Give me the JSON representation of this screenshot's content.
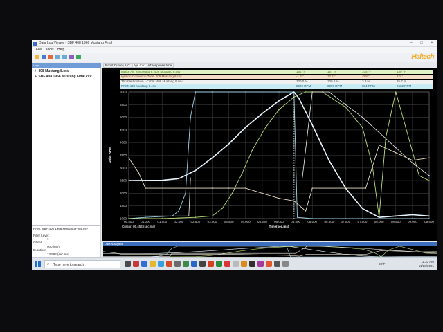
{
  "window": {
    "title": "Data Log Viewer - SBF 408 1966 Mustang Final",
    "logo_text": "Haltech"
  },
  "menu": {
    "items": [
      "File",
      "Tools",
      "Help"
    ]
  },
  "left_panel": {
    "header": "Logs",
    "files": [
      "408 Mustang 8.csv",
      "SBF 408 1966 Mustang Final.csv"
    ],
    "selected_series": "RPM: SBF 408 1966 Mustang Final.csv",
    "filter_label": "Filter Level:",
    "filter_value": "1",
    "offset_label": "Offset:",
    "offset_value": "000 (ms)",
    "duration_label": "Duration:",
    "duration_value": "13.592 (sec.ms)"
  },
  "tabs": [
    {
      "label": "Boost Curve",
      "active": false
    },
    {
      "label": "IAT",
      "active": false
    },
    {
      "label": "Ign Corr",
      "active": true
    },
    {
      "label": "IAT response time",
      "active": false
    }
  ],
  "legend": [
    {
      "name": "Intake Air Temperature: 408 Mustang 8.csv",
      "cursor": "154 °F",
      "max": "157 °F",
      "min": "105 °F",
      "avg": "130 °F",
      "bg": "#dff2c4",
      "color": "#5a7f1c"
    },
    {
      "name": "Ignition Correction Total: 408 Mustang 8.csv",
      "cursor": "-1.6 °",
      "max": "12.4 °",
      "min": "-3.8 °",
      "avg": "2.1 °",
      "bg": "#f3dcc8",
      "color": "#7a4c26"
    },
    {
      "name": "Throttle Position - Cable: 408 Mustang 8.csv",
      "cursor": "100.0 %",
      "max": "100.0 %",
      "min": "3.3 %",
      "avg": "35.7 %",
      "bg": "#f0f0f0",
      "color": "#555555"
    },
    {
      "name": "RPM: 408 Mustang 8.csv",
      "cursor": "5999 RPM",
      "max": "6090 RPM",
      "min": "884 RPM",
      "avg": "2632 RPM",
      "bg": "#c8ecf4",
      "color": "#1b5b74"
    }
  ],
  "chart_data": {
    "type": "line",
    "ylabel": "Units RPM",
    "xlabel": "Time(sec.ms)",
    "cursor_label": "Cursor: 05.454 (sec.ms)",
    "y_ticks": [
      "6000",
      "5500",
      "5000",
      "4500",
      "4000",
      "3500",
      "3000",
      "2500",
      "2000",
      "1500",
      "1000"
    ],
    "x_ticks": [
      "00.500",
      "01.000",
      "01.500",
      "02.000",
      "02.500",
      "03.000",
      "03.500",
      "04.000",
      "04.500",
      "05.000",
      "05.500",
      "06.000",
      "06.500",
      "07.000",
      "07.500",
      "08.000",
      "08.500",
      "09.000",
      "09.500"
    ],
    "ylim": [
      1000,
      6000
    ],
    "xlim": [
      0.5,
      9.5
    ],
    "cursor_x": 5.454,
    "grid": true,
    "series": [
      {
        "name": "RPM: 408 Mustang 8.csv",
        "color": "#e8f6ff",
        "width": 1.6,
        "x": [
          0.5,
          1.5,
          2.0,
          2.5,
          3.0,
          3.5,
          4.0,
          4.5,
          5.0,
          5.45,
          5.6,
          6.0,
          6.5,
          7.0,
          7.5,
          8.0,
          8.5,
          9.0,
          9.5
        ],
        "y": [
          2500,
          2510,
          2580,
          2900,
          3400,
          3950,
          4600,
          5150,
          5650,
          6000,
          5750,
          4700,
          3300,
          2200,
          1400,
          1050,
          1100,
          1150,
          1100
        ]
      },
      {
        "name": "Throttle Position - Cable: 408 Mustang 8.csv",
        "color": "#9fd4e8",
        "width": 0.9,
        "x": [
          0.5,
          1.0,
          1.8,
          2.0,
          2.2,
          2.35,
          2.5,
          3.0,
          4.0,
          5.0,
          5.45,
          5.55,
          6.0,
          6.5,
          7.0,
          7.5,
          8.0,
          9.0,
          9.5
        ],
        "y": [
          1000,
          1050,
          1100,
          1300,
          2000,
          5000,
          6000,
          6000,
          6000,
          6000,
          6000,
          1050,
          1000,
          1000,
          1000,
          1000,
          1000,
          1000,
          1000
        ]
      },
      {
        "name": "Intake Air Temperature: 408 Mustang 8.csv",
        "color": "#b8e07a",
        "width": 0.9,
        "x": [
          0.5,
          1.5,
          2.5,
          3.0,
          3.3,
          3.6,
          3.9,
          4.2,
          4.6,
          5.0,
          5.45,
          5.8,
          6.3,
          7.0,
          7.5,
          7.8,
          8.0,
          8.2,
          8.5,
          8.8,
          9.2,
          9.5
        ],
        "y": [
          1000,
          1000,
          1050,
          1100,
          1400,
          2000,
          2800,
          3700,
          4600,
          5300,
          5800,
          6000,
          6000,
          5400,
          4600,
          3100,
          1050,
          4200,
          6000,
          4600,
          2700,
          2500
        ]
      },
      {
        "name": "Ignition Correction Total: 408 Mustang 8.csv",
        "color": "#eadfc4",
        "width": 0.9,
        "x": [
          0.5,
          0.8,
          1.0,
          2.0,
          3.0,
          3.5,
          4.0,
          4.5,
          5.0,
          5.45,
          5.8,
          6.0,
          7.0,
          7.6,
          8.0,
          8.5,
          9.0,
          9.5
        ],
        "y": [
          3400,
          2800,
          2200,
          2200,
          2200,
          2200,
          2200,
          2000,
          1800,
          1700,
          1300,
          2200,
          2200,
          2200,
          3900,
          3600,
          3300,
          3400
        ]
      },
      {
        "name": "Boost Curve",
        "color": "#f2f2f2",
        "width": 0.8,
        "x": [
          0.5,
          2.3,
          2.35,
          5.7,
          6.0,
          6.5,
          7.0,
          7.5,
          8.0,
          8.5,
          9.0,
          9.5
        ],
        "y": [
          1100,
          1100,
          2600,
          2600,
          6000,
          6000,
          5500,
          5000,
          4400,
          3800,
          3200,
          2700
        ]
      }
    ]
  },
  "navigator": {
    "label": "Data Navigator"
  },
  "taskbar": {
    "search_placeholder": "Type here to search",
    "weather": "83°F",
    "time": "11:33 AM",
    "date": "11/28/2021"
  }
}
